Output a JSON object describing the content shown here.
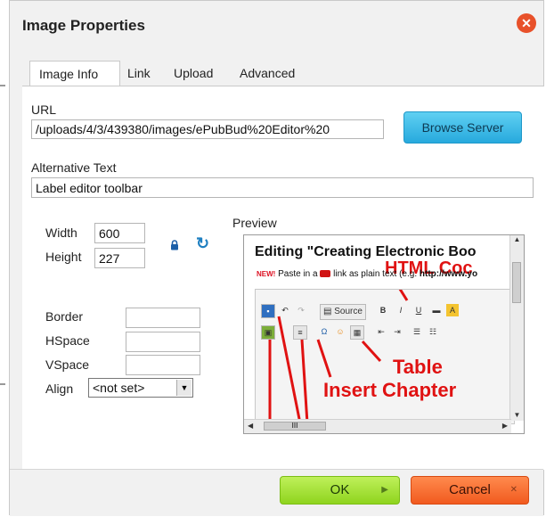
{
  "dialog": {
    "title": "Image Properties",
    "close_icon": "close-icon"
  },
  "tabs": [
    {
      "label": "Image Info",
      "active": true
    },
    {
      "label": "Link",
      "active": false
    },
    {
      "label": "Upload",
      "active": false
    },
    {
      "label": "Advanced",
      "active": false
    }
  ],
  "form": {
    "url_label": "URL",
    "url_value": "/uploads/4/3/439380/images/ePubBud%20Editor%20",
    "browse_label": "Browse Server",
    "alt_label": "Alternative Text",
    "alt_value": "Label editor toolbar",
    "width_label": "Width",
    "width_value": "600",
    "height_label": "Height",
    "height_value": "227",
    "border_label": "Border",
    "border_value": "",
    "hspace_label": "HSpace",
    "hspace_value": "",
    "vspace_label": "VSpace",
    "vspace_value": "",
    "align_label": "Align",
    "align_value": "<not set>",
    "preview_label": "Preview"
  },
  "preview": {
    "heading": "Editing \"Creating Electronic Boo",
    "new_badge": "NEW!",
    "note_text": "Paste in a",
    "note_text_2": "link as plain text (e.g.",
    "note_url": "http://www.yo",
    "source_label": "Source",
    "annotation_html": "HTML Coc",
    "annotation_table": "Table",
    "annotation_chapter": "Insert Chapter",
    "scroll_thumb_label": "III"
  },
  "footer": {
    "ok_label": "OK",
    "cancel_label": "Cancel"
  },
  "colors": {
    "close": "#e8512a",
    "browse": "#27a9dd",
    "ok": "#8fd41e",
    "cancel": "#f15a1f",
    "annotation": "#e01212"
  }
}
